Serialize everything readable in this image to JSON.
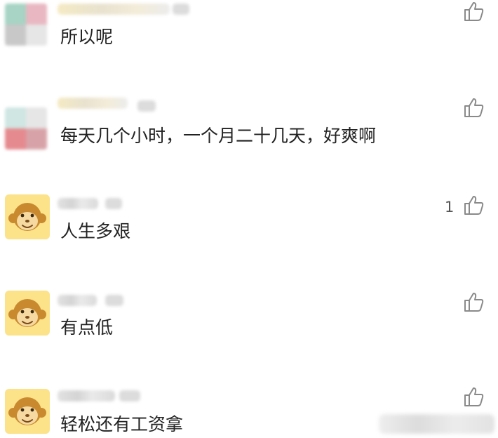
{
  "comments": [
    {
      "text": "所以呢",
      "likes": "",
      "avatar": "mosaic-avatar"
    },
    {
      "text": "每天几个小时，一个月二十几天，好爽啊",
      "likes": "",
      "avatar": "mosaic-avatar"
    },
    {
      "text": "人生多艰",
      "likes": "1",
      "avatar": "monkey-avatar"
    },
    {
      "text": "有点低",
      "likes": "",
      "avatar": "monkey-avatar"
    },
    {
      "text": "轻松还有工资拿",
      "likes": "",
      "avatar": "monkey-avatar"
    }
  ],
  "icons": {
    "like": "thumbs-up-icon",
    "avatar_default": "monkey-face-icon"
  },
  "colors": {
    "avatar_bg": "#fce38a",
    "monkey_fur": "#c98a2f",
    "text": "#222222",
    "icon": "#8a8a8a"
  }
}
